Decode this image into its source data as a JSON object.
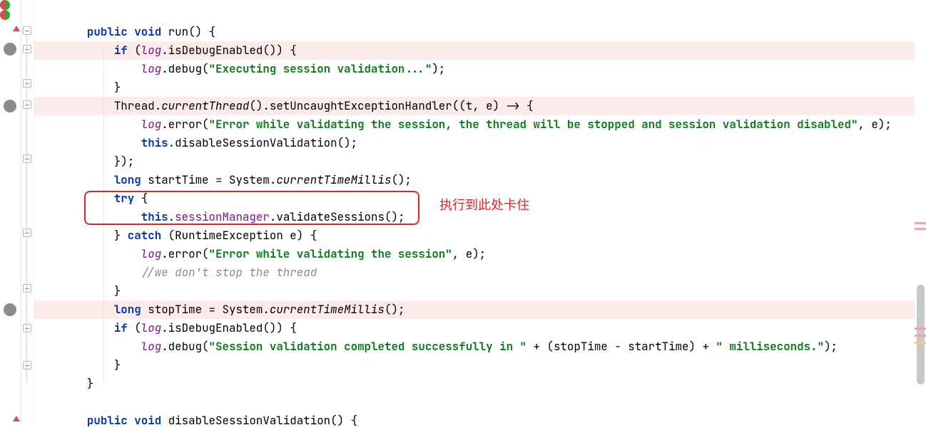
{
  "annotation": "执行到此处卡住",
  "code": {
    "l1": {
      "kw1": "public",
      "kw2": "void",
      "name": "run",
      "rest": "() {"
    },
    "l2": {
      "kw": "if",
      "open": " (",
      "log": "log",
      "rest": ".isDebugEnabled()) {"
    },
    "l3": {
      "log": "log",
      "dot": ".debug(",
      "str": "\"Executing session validation...\"",
      "end": ");"
    },
    "l4": "}",
    "l5": {
      "pre": "Thread.",
      "ital": "currentThread",
      "rest": "().setUncaughtExceptionHandler((t, e) -> {"
    },
    "l6": {
      "log": "log",
      "dot": ".error(",
      "str": "\"Error while validating the session, the thread will be stopped and session validation disabled\"",
      "end": ", e);"
    },
    "l7": {
      "kw": "this",
      "rest": ".disableSessionValidation();"
    },
    "l8": "});",
    "l9": {
      "kw": "long ",
      "ident": "startTime = System.",
      "ital": "currentTimeMillis",
      "rest": "();"
    },
    "l10": {
      "kw": "try",
      "rest": " {"
    },
    "l11": {
      "kw": "this",
      "dot": ".",
      "sm": "sessionManager",
      "rest": ".validateSessions();"
    },
    "l12": {
      "brace": "} ",
      "kw": "catch",
      "rest": " (RuntimeException e) {"
    },
    "l13": {
      "log": "log",
      "dot": ".error(",
      "str": "\"Error while validating the session\"",
      "end": ", e);"
    },
    "l14": "//we don't stop the thread",
    "l15": "}",
    "l16": {
      "kw": "long ",
      "ident": "stopTime = System.",
      "ital": "currentTimeMillis",
      "rest": "();"
    },
    "l17": {
      "kw": "if",
      "open": " (",
      "log": "log",
      "rest": ".isDebugEnabled()) {"
    },
    "l18": {
      "log": "log",
      "dot": ".debug(",
      "str": "\"Session validation completed successfully in \"",
      "mid": " + (stopTime - startTime) + ",
      "str2": "\" milliseconds.\"",
      "end": ");"
    },
    "l19": "}",
    "l20": "}",
    "l21": "",
    "l22": {
      "kw1": "public",
      "kw2": "void",
      "name": "disableSessionValidation",
      "rest": "() {"
    }
  }
}
